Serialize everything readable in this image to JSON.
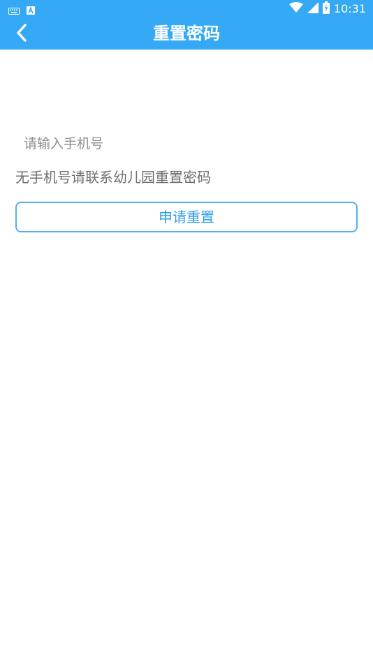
{
  "status_bar": {
    "time": "10:31",
    "icons": [
      "keyboard-icon",
      "a-notification-icon",
      "wifi-icon",
      "cellular-signal-icon",
      "battery-charging-icon"
    ]
  },
  "header": {
    "title": "重置密码",
    "back_icon": "chevron-left-icon"
  },
  "form": {
    "phone_placeholder": "请输入手机号",
    "phone_value": "",
    "hint": "无手机号请联系幼儿园重置密码",
    "submit_label": "申请重置"
  },
  "colors": {
    "primary": "#35a9f5",
    "button_border": "#52b0ee",
    "button_text": "#2f9de8",
    "hint_text": "#6f6f6f",
    "placeholder_text": "#8e8e8e"
  }
}
